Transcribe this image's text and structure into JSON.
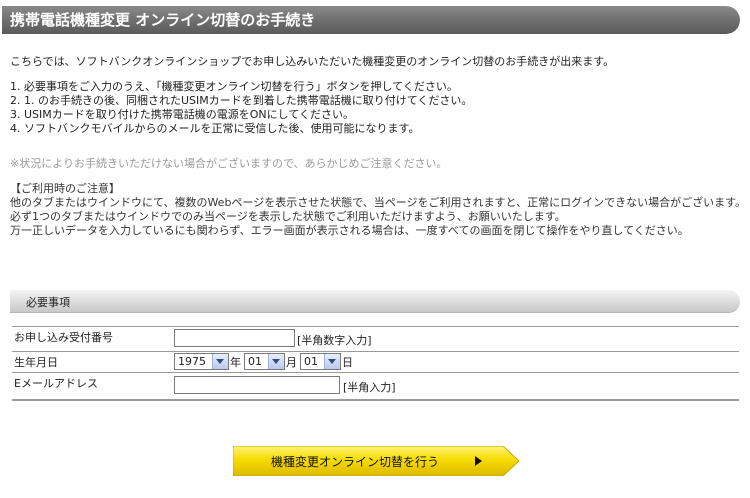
{
  "header": {
    "title": "携帯電話機種変更 オンライン切替のお手続き"
  },
  "intro": "こちらでは、ソフトバンクオンラインショップでお申し込みいただいた機種変更のオンライン切替のお手続きが出来ます。",
  "steps": [
    "1. 必要事項をご入力のうえ、「機種変更オンライン切替を行う」ボタンを押してください。",
    "2. 1. のお手続きの後、同梱されたUSIMカードを到着した携帯電話機に取り付けてください。",
    "3. USIMカードを取り付けた携帯電話機の電源をONにしてください。",
    "4. ソフトバンクモバイルからのメールを正常に受信した後、使用可能になります。"
  ],
  "note": "※状況によりお手続きいただけない場合がございますので、あらかじめご注意ください。",
  "cautions": {
    "heading": "【ご利用時のご注意】",
    "lines": [
      "他のタブまたはウインドウにて、複数のWebページを表示させた状態で、当ページをご利用されますと、正常にログインできない場合がございます。",
      "必ず1つのタブまたはウインドウでのみ当ページを表示した状態でご利用いただけますよう、お願いいたします。",
      "万一正しいデータを入力しているにも関わらず、エラー画面が表示される場合は、一度すべての画面を閉じて操作をやり直してください。"
    ]
  },
  "section": {
    "title": "必要事項"
  },
  "form": {
    "application_number": {
      "label": "お申し込み受付番号",
      "value": "",
      "hint": "[半角数字入力]"
    },
    "birthdate": {
      "label": "生年月日",
      "year": "1975",
      "year_unit": "年",
      "month": "01",
      "month_unit": "月",
      "day": "01",
      "day_unit": "日"
    },
    "email": {
      "label": "Eメールアドレス",
      "value": "",
      "hint": "[半角入力]"
    }
  },
  "submit": {
    "label": "機種変更オンライン切替を行う"
  },
  "colors": {
    "title_bar": "#707070",
    "button_yellow": "#f2d100"
  }
}
